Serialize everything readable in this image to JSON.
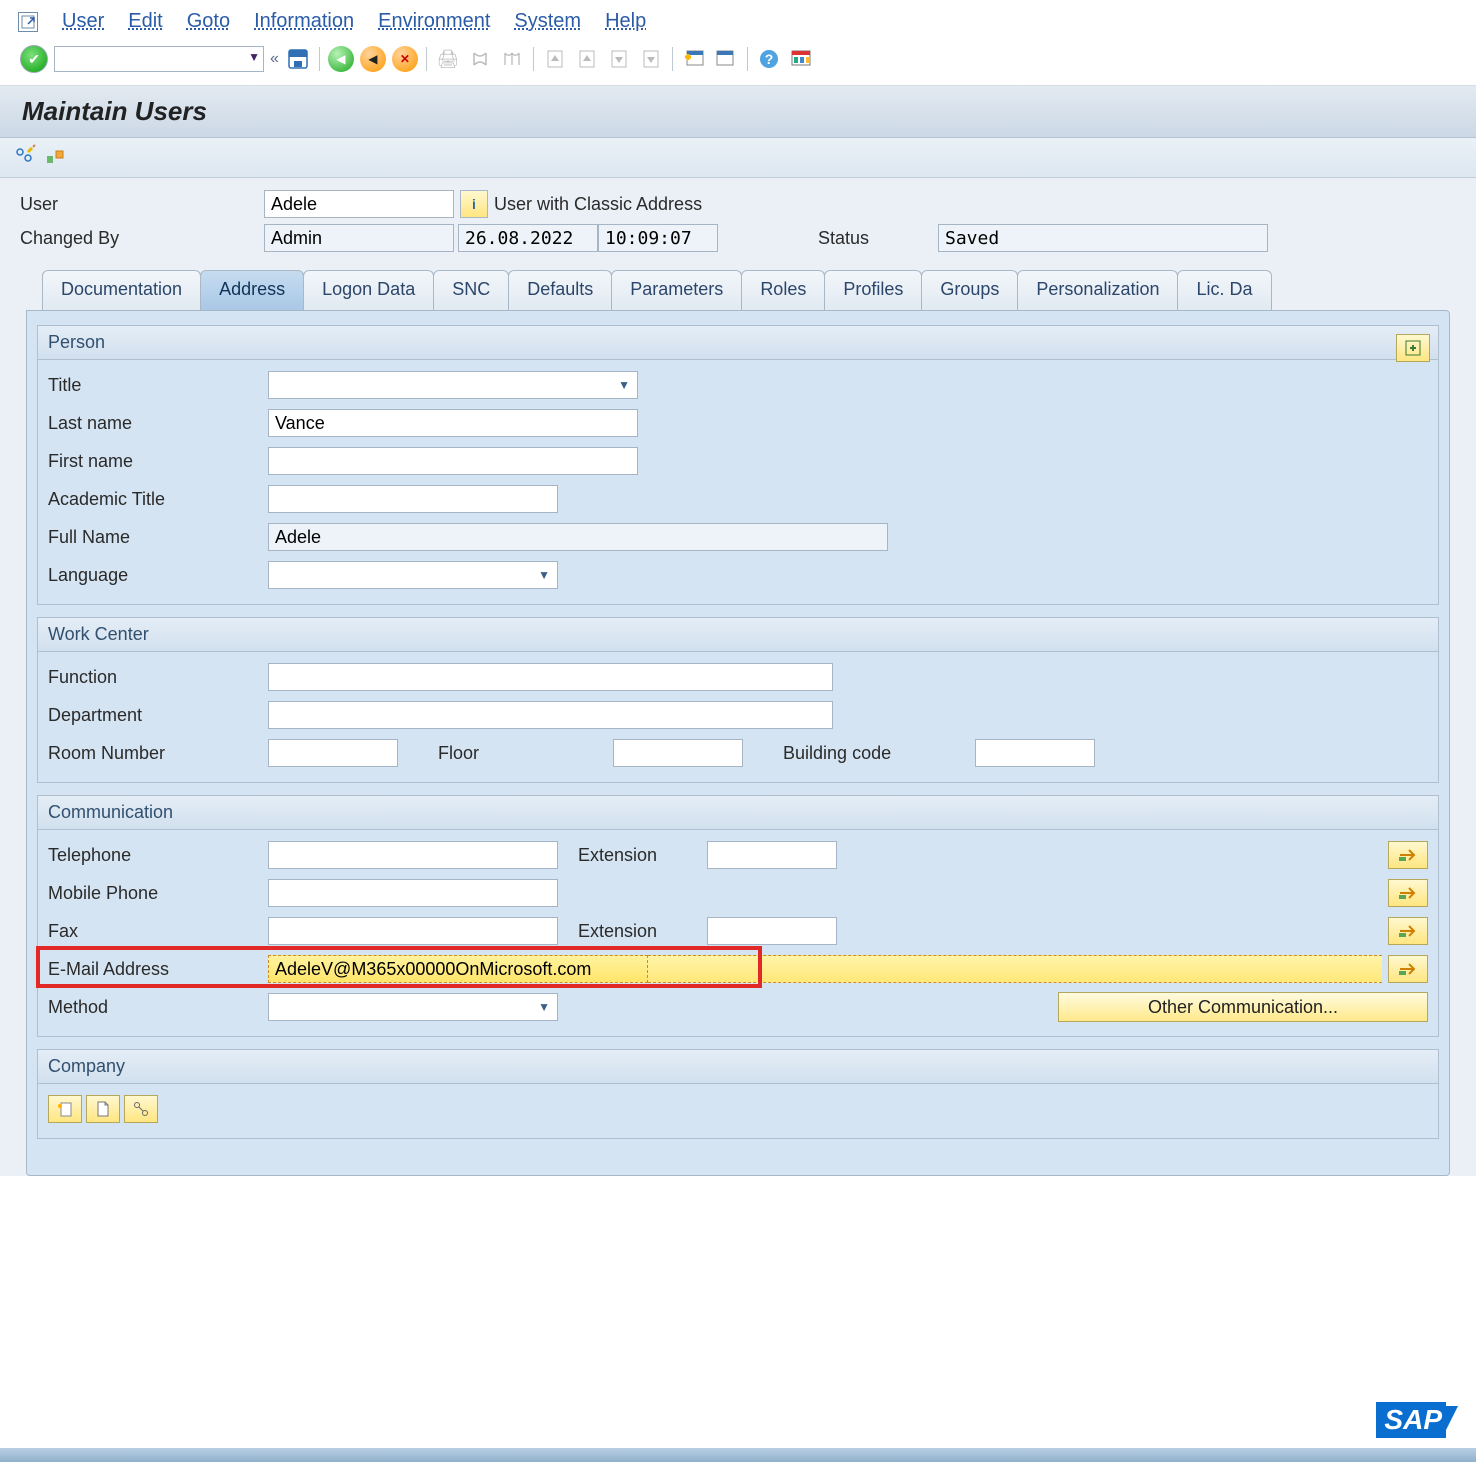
{
  "menu": {
    "items": [
      "User",
      "Edit",
      "Goto",
      "Information",
      "Environment",
      "System",
      "Help"
    ]
  },
  "toolbar": {
    "command": ""
  },
  "page_title": "Maintain Users",
  "header": {
    "user_label": "User",
    "user_value": "Adele",
    "classic_addr": "User with Classic Address",
    "changed_by_label": "Changed By",
    "changed_by_value": "Admin",
    "changed_date": "26.08.2022",
    "changed_time": "10:09:07",
    "status_label": "Status",
    "status_value": "Saved"
  },
  "tabs": [
    "Documentation",
    "Address",
    "Logon Data",
    "SNC",
    "Defaults",
    "Parameters",
    "Roles",
    "Profiles",
    "Groups",
    "Personalization",
    "Lic. Da"
  ],
  "active_tab": "Address",
  "person": {
    "title": "Person",
    "fields": {
      "title_label": "Title",
      "title_value": "",
      "lastname_label": "Last name",
      "lastname_value": "Vance",
      "firstname_label": "First name",
      "firstname_value": "",
      "acad_label": "Academic Title",
      "acad_value": "",
      "fullname_label": "Full Name",
      "fullname_value": "Adele",
      "language_label": "Language",
      "language_value": ""
    }
  },
  "workcenter": {
    "title": "Work Center",
    "function_label": "Function",
    "function_value": "",
    "department_label": "Department",
    "department_value": "",
    "room_label": "Room Number",
    "room_value": "",
    "floor_label": "Floor",
    "floor_value": "",
    "building_label": "Building code",
    "building_value": ""
  },
  "communication": {
    "title": "Communication",
    "telephone_label": "Telephone",
    "telephone_value": "",
    "extension_label": "Extension",
    "telephone_ext": "",
    "mobile_label": "Mobile Phone",
    "mobile_value": "",
    "fax_label": "Fax",
    "fax_value": "",
    "fax_ext": "",
    "email_label": "E-Mail Address",
    "email_value": "AdeleV@M365x00000OnMicrosoft.com",
    "method_label": "Method",
    "method_value": "",
    "other_comm": "Other Communication..."
  },
  "company": {
    "title": "Company"
  }
}
